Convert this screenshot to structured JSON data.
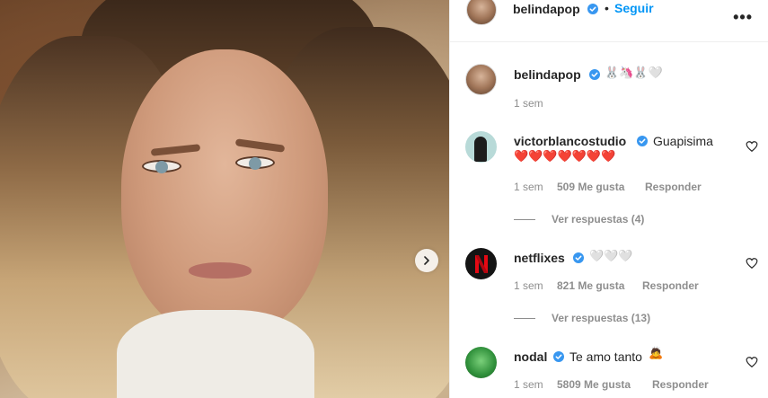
{
  "post": {
    "author": {
      "username": "belindapop",
      "verified": true
    },
    "follow_separator": "•",
    "follow_label": "Seguir",
    "more_label": "•••",
    "caption": {
      "emojis": "🐰🦄🐰🤍",
      "time": "1 sem"
    }
  },
  "comments": [
    {
      "username": "victorblancostudio",
      "verified": true,
      "text": "Guapisima",
      "emojis": "❤️❤️❤️❤️❤️❤️❤️",
      "time": "1 sem",
      "likes": "509 Me gusta",
      "reply_label": "Responder",
      "view_replies": "Ver respuestas (4)"
    },
    {
      "username": "netflixes",
      "verified": true,
      "text": "",
      "emojis": "🤍🤍🤍",
      "time": "1 sem",
      "likes": "821 Me gusta",
      "reply_label": "Responder",
      "view_replies": "Ver respuestas (13)"
    },
    {
      "username": "nodal",
      "verified": true,
      "text": "Te amo tanto",
      "emojis": "🙇",
      "time": "1 sem",
      "likes": "5809 Me gusta",
      "reply_label": "Responder",
      "view_replies": ""
    }
  ],
  "colors": {
    "accent": "#0095f6",
    "verified": "#3897f0",
    "muted": "#8e8e8e",
    "text": "#262626",
    "heart_red": "#ed4956"
  },
  "icons": {
    "next": "chevron-right-icon",
    "verified": "verified-badge-icon",
    "like": "heart-outline-icon",
    "netflix": "netflix-n-icon"
  }
}
